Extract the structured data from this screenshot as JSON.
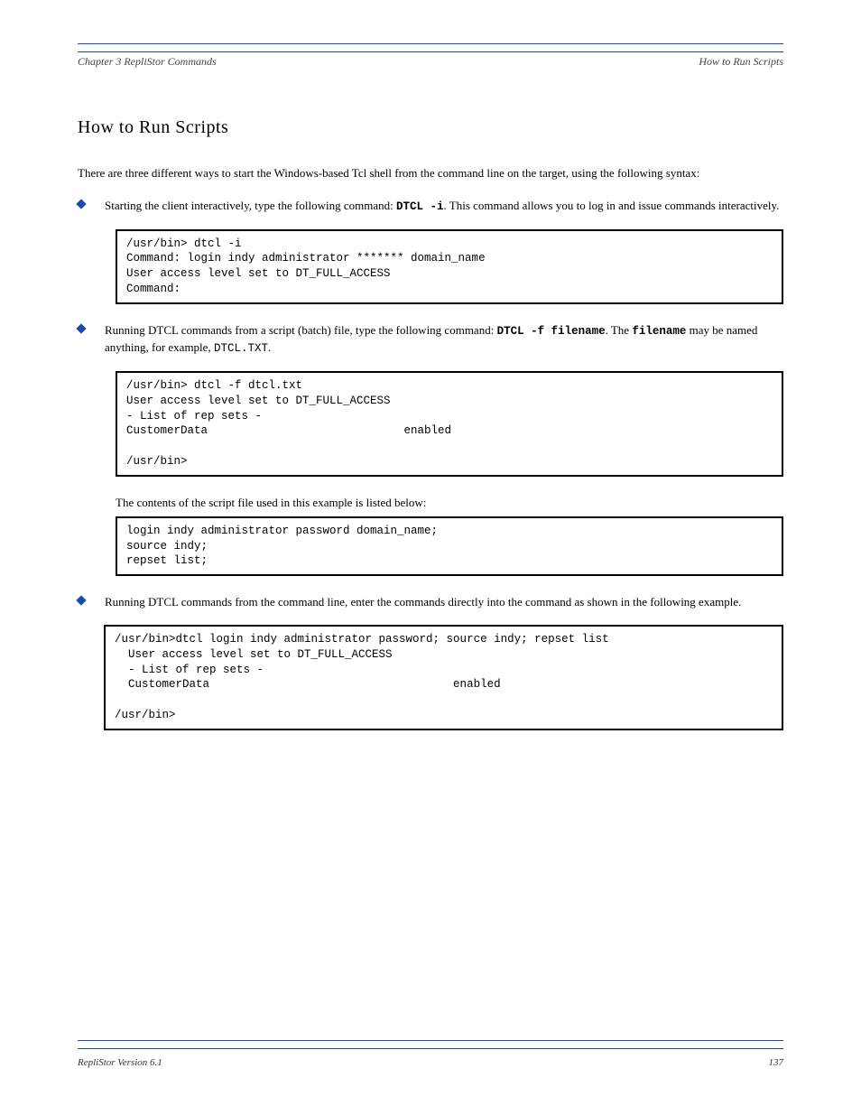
{
  "header": {
    "left": "Chapter 3 RepliStor Commands",
    "right": "How to Run Scripts"
  },
  "title": "How to Run Scripts",
  "intro": "There are three different ways to start the Windows-based Tcl shell from the command line on the target, using the following syntax:",
  "bullets": [
    {
      "pre": "Starting the client interactively, type the following command: ",
      "code": "DTCL -i",
      "post": ". This command allows you to log in and issue commands interactively."
    },
    {
      "pre": "Running DTCL commands from a script (batch) file, type the following command: ",
      "code": "DTCL -f filename",
      "mid": ". The ",
      "code2": "filename",
      "post": " may be named anything, for example, ",
      "code3": "DTCL.TXT",
      "tail": "."
    },
    {
      "pre": "Running DTCL commands from the command line, enter the commands directly into the command as shown in the following example.",
      "code": "",
      "post": ""
    }
  ],
  "codeblocks": {
    "interactive": "/usr/bin> dtcl -i\nCommand: login indy administrator ******* domain_name\nUser access level set to DT_FULL_ACCESS\nCommand:",
    "script_run": "/usr/bin> dtcl -f dtcl.txt\nUser access level set to DT_FULL_ACCESS\n- List of rep sets -\nCustomerData                             enabled\n\n/usr/bin>",
    "script_contents": "login indy administrator password domain_name;\nsource indy;\nrepset list;",
    "cmdline": "/usr/bin>dtcl login indy administrator password; source indy; repset list\n  User access level set to DT_FULL_ACCESS\n  - List of rep sets -\n  CustomerData                                    enabled\n\n/usr/bin>"
  },
  "script_label": "The contents of the script file used in this example is listed below:",
  "footer": {
    "left": "RepliStor Version 6.1",
    "right": "137"
  }
}
